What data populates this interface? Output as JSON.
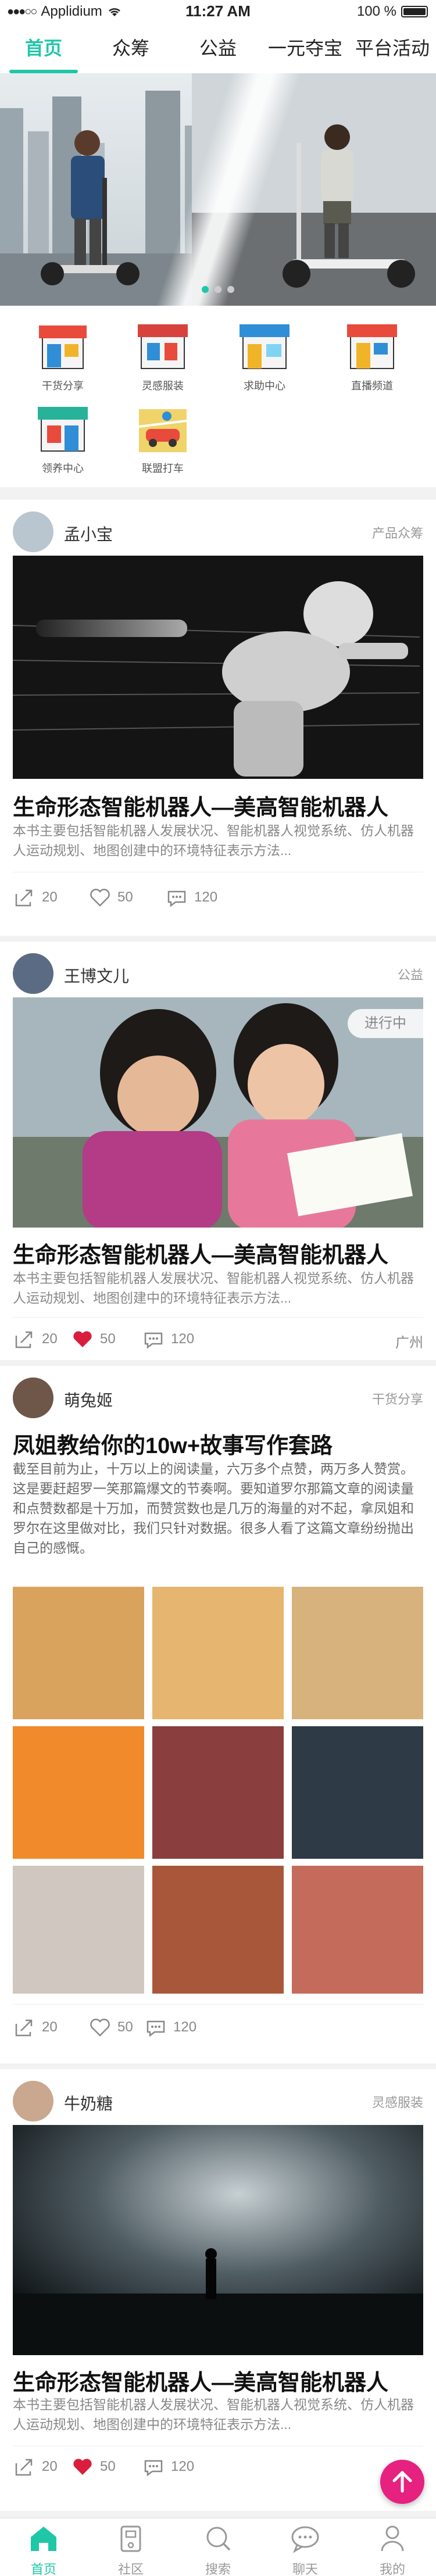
{
  "status": {
    "carrier": "Applidium",
    "time": "11:27 AM",
    "battery": "100 %"
  },
  "tabs": [
    {
      "label": "首页",
      "active": true
    },
    {
      "label": "众筹",
      "active": false
    },
    {
      "label": "公益",
      "active": false
    },
    {
      "label": "一元夺宝",
      "active": false
    },
    {
      "label": "平台活动",
      "active": false
    }
  ],
  "quick": [
    {
      "label": "干货分享",
      "icon": "shop-icon",
      "color": "#e84a3b"
    },
    {
      "label": "灵感服装",
      "icon": "clothing-store-icon",
      "color": "#2f8ed6"
    },
    {
      "label": "求助中心",
      "icon": "help-center-icon",
      "color": "#f0b429"
    },
    {
      "label": "直播频道",
      "icon": "live-channel-icon",
      "color": "#e84a3b"
    },
    {
      "label": "领养中心",
      "icon": "adoption-center-icon",
      "color": "#27b39a"
    },
    {
      "label": "联盟打车",
      "icon": "taxi-map-icon",
      "color": "#f0b429"
    }
  ],
  "cards": [
    {
      "user": "孟小宝",
      "category": "产品众筹",
      "title": "生命形态智能机器人—美高智能机器人",
      "desc": "本书主要包括智能机器人发展状况、智能机器人视觉系统、仿人机器人运动规划、地图创建中的环境特征表示方法...",
      "shares": "20",
      "likes": "50",
      "comments": "120",
      "location": ""
    },
    {
      "user": "王博文儿",
      "category": "公益",
      "badge": "进行中",
      "title": "生命形态智能机器人—美高智能机器人",
      "desc": "本书主要包括智能机器人发展状况、智能机器人视觉系统、仿人机器人运动规划、地图创建中的环境特征表示方法...",
      "shares": "20",
      "likes": "50",
      "comments": "120",
      "location": "广州"
    },
    {
      "user": "萌兔姬",
      "category": "干货分享",
      "title": "凤姐教给你的10w+故事写作套路",
      "desc": "截至目前为止，十万以上的阅读量，六万多个点赞，两万多人赞赏。这是要赶超罗一笑那篇爆文的节奏啊。要知道罗尔那篇文章的阅读量和点赞数都是十万加，而赞赏数也是几万的海量的对不起，拿凤姐和罗尔在这里做对比，我们只针对数据。很多人看了这篇文章纷纷抛出自己的感慨。",
      "shares": "20",
      "likes": "50",
      "comments": "120",
      "location": ""
    },
    {
      "user": "牛奶糖",
      "category": "灵感服装",
      "title": "生命形态智能机器人—美高智能机器人",
      "desc": "本书主要包括智能机器人发展状况、智能机器人视觉系统、仿人机器人运动规划、地图创建中的环境特征表示方法...",
      "shares": "20",
      "likes": "50",
      "comments": "120",
      "location": ""
    }
  ],
  "nav": [
    {
      "label": "首页",
      "icon": "home-icon",
      "active": true
    },
    {
      "label": "社区",
      "icon": "community-icon",
      "active": false
    },
    {
      "label": "搜索",
      "icon": "search-icon",
      "active": false
    },
    {
      "label": "聊天",
      "icon": "chat-icon",
      "active": false
    },
    {
      "label": "我的",
      "icon": "profile-icon",
      "active": false
    }
  ],
  "colors": {
    "accent": "#1fc7a7",
    "like_active": "#d81e3c",
    "fab": "#e6217f"
  }
}
